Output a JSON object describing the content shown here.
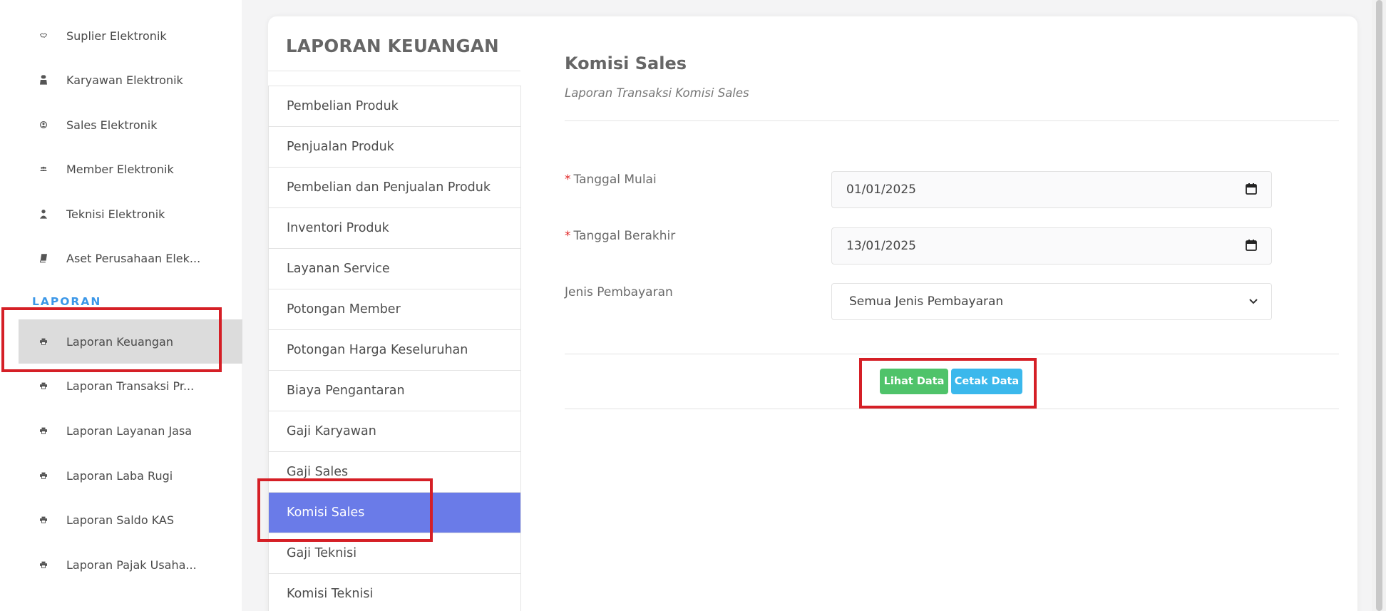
{
  "sidebar": {
    "items": [
      {
        "label": "Suplier Elektronik",
        "icon": "handshake-icon"
      },
      {
        "label": "Karyawan Elektronik",
        "icon": "briefcase-icon"
      },
      {
        "label": "Sales Elektronik",
        "icon": "user-circle-icon"
      },
      {
        "label": "Member Elektronik",
        "icon": "users-icon"
      },
      {
        "label": "Teknisi Elektronik",
        "icon": "user-icon"
      },
      {
        "label": "Aset Perusahaan Elek...",
        "icon": "book-icon"
      }
    ],
    "section": "LAPORAN",
    "reports": [
      {
        "label": "Laporan Keuangan",
        "icon": "printer-icon",
        "active": true
      },
      {
        "label": "Laporan Transaksi Pr...",
        "icon": "printer-icon"
      },
      {
        "label": "Laporan Layanan Jasa",
        "icon": "printer-icon"
      },
      {
        "label": "Laporan Laba Rugi",
        "icon": "printer-icon"
      },
      {
        "label": "Laporan Saldo KAS",
        "icon": "printer-icon"
      },
      {
        "label": "Laporan Pajak Usaha...",
        "icon": "printer-icon"
      }
    ]
  },
  "panel": {
    "title": "LAPORAN KEUANGAN",
    "menu": [
      "Pembelian Produk",
      "Penjualan Produk",
      "Pembelian dan Penjualan Produk",
      "Inventori Produk",
      "Layanan Service",
      "Potongan Member",
      "Potongan Harga Keseluruhan",
      "Biaya Pengantaran",
      "Gaji Karyawan",
      "Gaji Sales",
      "Komisi Sales",
      "Gaji Teknisi",
      "Komisi Teknisi"
    ],
    "active_menu": "Komisi Sales"
  },
  "content": {
    "title": "Komisi Sales",
    "subtitle": "Laporan Transaksi Komisi Sales",
    "required_mark": "*",
    "start_label": "Tanggal Mulai",
    "start_value": "01/01/2025",
    "end_label": "Tanggal Berakhir",
    "end_value": "13/01/2025",
    "payment_label": "Jenis Pembayaran",
    "payment_value": "Semua Jenis Pembayaran",
    "view_button": "Lihat Data",
    "print_button": "Cetak Data"
  },
  "colors": {
    "accent": "#6a7be8",
    "section": "#3b97e8",
    "green": "#4fc36a",
    "blue": "#3bb8ec",
    "highlight": "#d51f26"
  }
}
